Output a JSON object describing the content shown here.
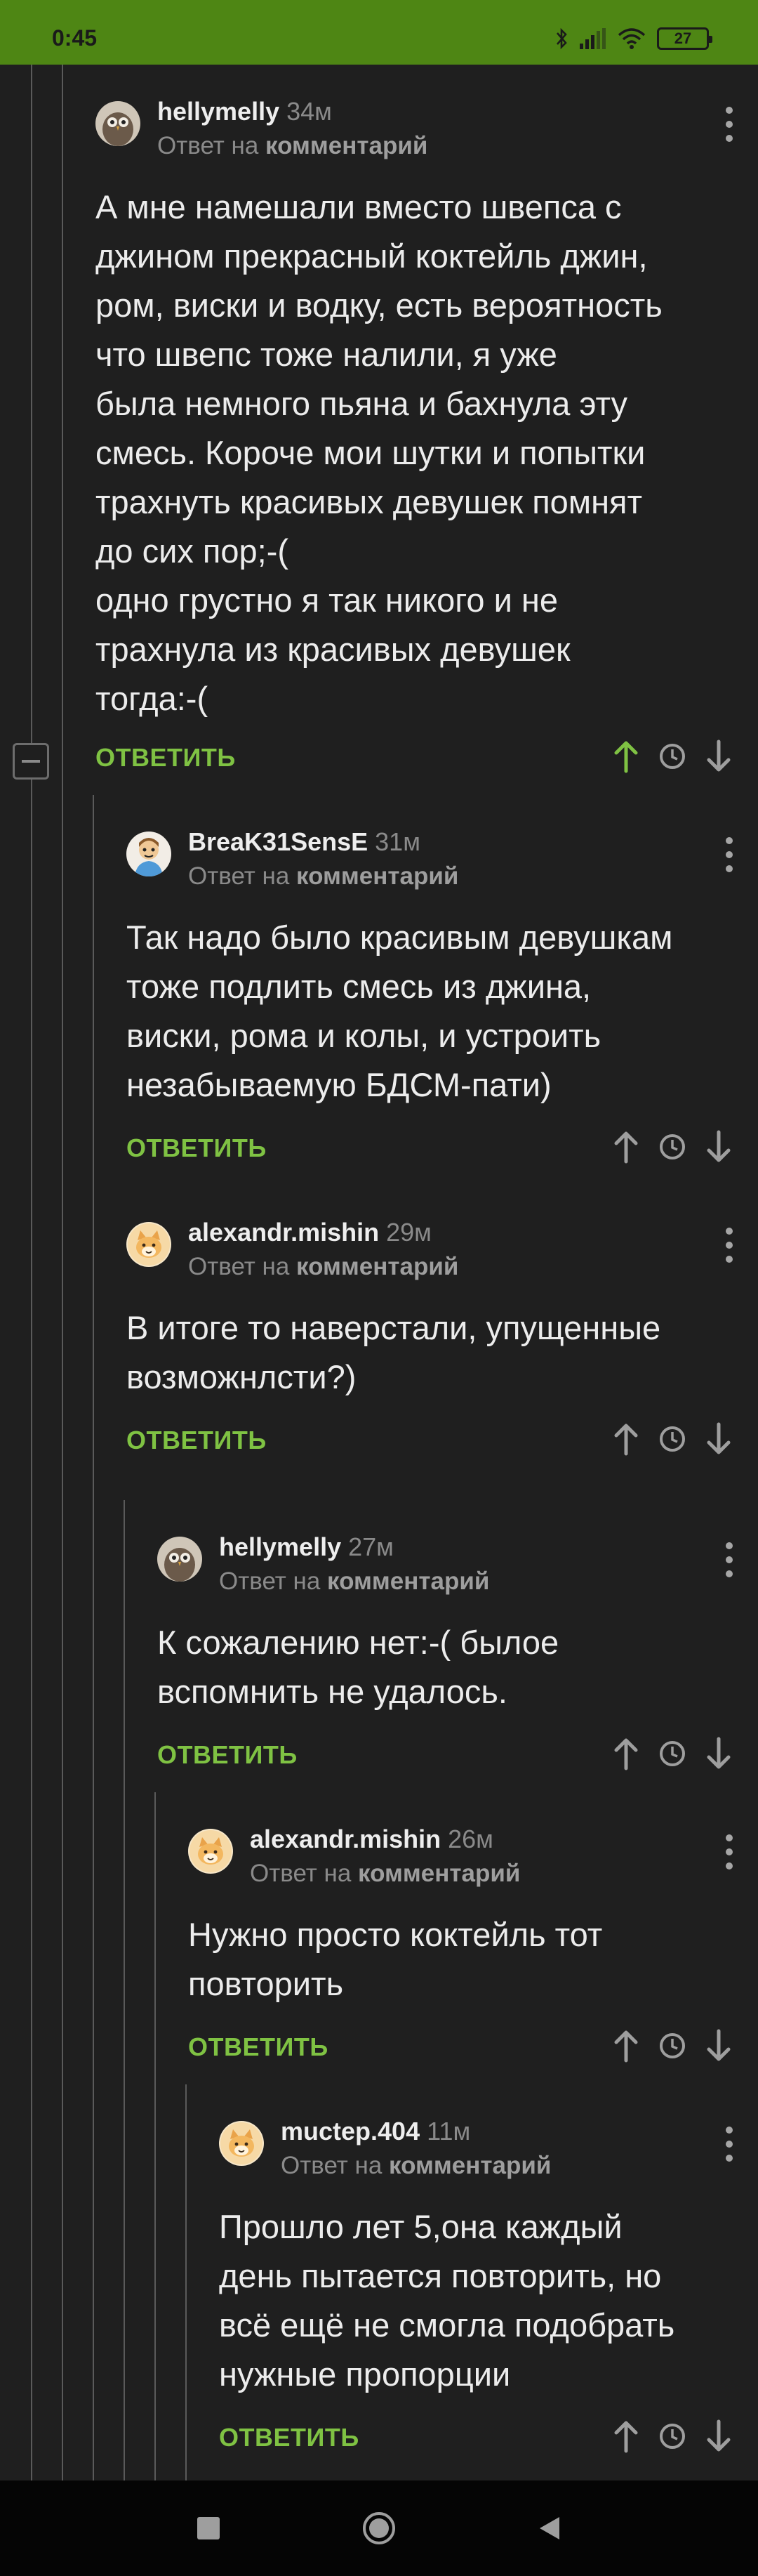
{
  "status_bar": {
    "time": "0:45",
    "battery": "27"
  },
  "collapse_symbol": "−",
  "comments": [
    {
      "author": "hellymelly",
      "time": "34м",
      "reply_prefix": "Ответ на",
      "reply_target": "комментарий",
      "text": "А мне намешали вместо швепса с\nджином прекрасный коктейль джин,\nром, виски и водку, есть вероятность\nчто швепс тоже налили, я уже\nбыла немного пьяна и бахнула эту\nсмесь. Короче мои шутки и попытки\nтрахнуть красивых девушек помнят\nдо сих пор;-(\nодно грустно я так никого и не\nтрахнула из красивых девушек\nтогда:-(",
      "reply_label": "ОТВЕТИТЬ",
      "upvoted": true,
      "avatar_icon": "owl-avatar-icon"
    },
    {
      "author": "BreaK31SensE",
      "time": "31м",
      "reply_prefix": "Ответ на",
      "reply_target": "комментарий",
      "text": "Так надо было красивым девушкам\nтоже подлить смесь из джина,\nвиски, рома и колы, и устроить\nнезабываемую БДСМ-пати)",
      "reply_label": "ОТВЕТИТЬ",
      "upvoted": false,
      "avatar_icon": "cartoon-man-avatar-icon"
    },
    {
      "author": "alexandr.mishin",
      "time": "29м",
      "reply_prefix": "Ответ на",
      "reply_target": "комментарий",
      "text": "В итоге то наверстали, упущенные\nвозможнлсти?)",
      "reply_label": "ОТВЕТИТЬ",
      "upvoted": false,
      "avatar_icon": "default-cat-avatar-icon"
    },
    {
      "author": "hellymelly",
      "time": "27м",
      "reply_prefix": "Ответ на",
      "reply_target": "комментарий",
      "text": "К сожалению нет:-( былое\nвспомнить не удалось.",
      "reply_label": "ОТВЕТИТЬ",
      "upvoted": false,
      "avatar_icon": "owl-avatar-icon"
    },
    {
      "author": "alexandr.mishin",
      "time": "26м",
      "reply_prefix": "Ответ на",
      "reply_target": "комментарий",
      "text": "Нужно просто коктейль тот\nповторить",
      "reply_label": "ОТВЕТИТЬ",
      "upvoted": false,
      "avatar_icon": "default-cat-avatar-icon"
    },
    {
      "author": "muctep.404",
      "time": "11м",
      "reply_prefix": "Ответ на",
      "reply_target": "комментарий",
      "text": "Прошло лет 5,она каждый\nдень пытается повторить, но\nвсё ещё не смогла подобрать\nнужные пропорции",
      "reply_label": "ОТВЕТИТЬ",
      "upvoted": false,
      "avatar_icon": "default-cat-avatar-icon"
    }
  ],
  "colors": {
    "status_bar": "#4e8614",
    "background": "#1f1f1f",
    "accent_green": "#7fc243",
    "nav_bar": "#050505"
  }
}
